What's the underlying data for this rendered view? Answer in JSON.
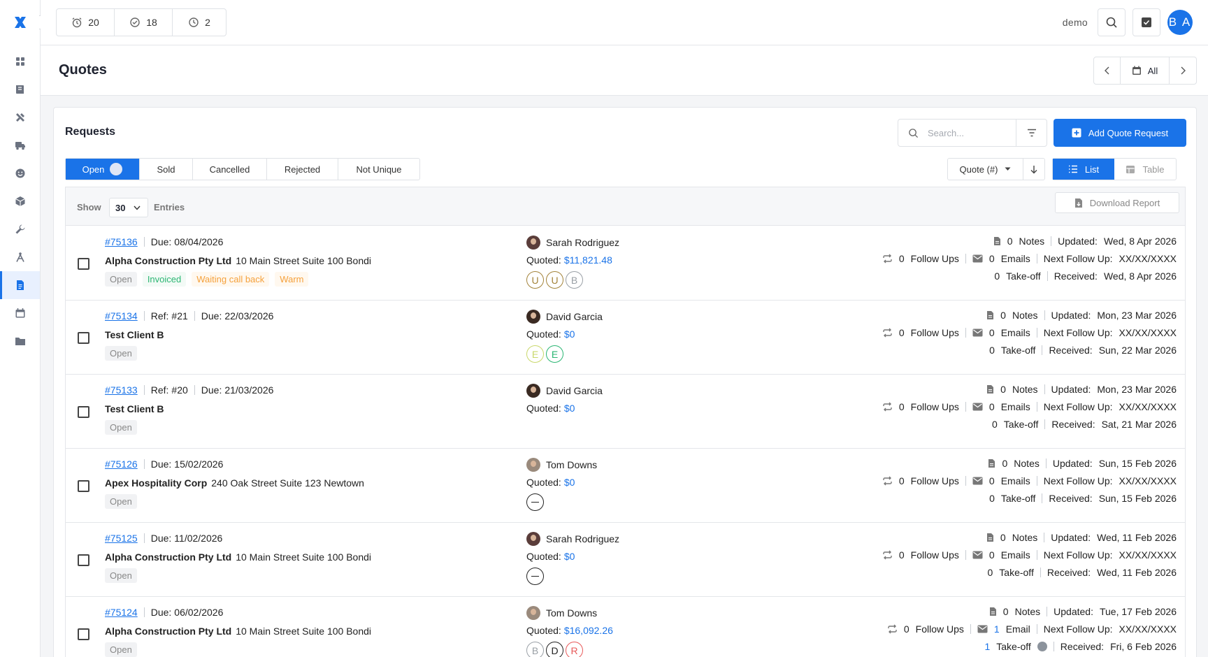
{
  "topbar": {
    "counters": [
      {
        "icon": "alarm-clock-icon",
        "value": "20"
      },
      {
        "icon": "check-circle-icon",
        "value": "18"
      },
      {
        "icon": "clock-progress-icon",
        "value": "2"
      }
    ],
    "user_name": "demo",
    "avatar_initials": "B A"
  },
  "sidebar": {
    "items": [
      {
        "name": "dashboard",
        "icon": "grid-icon"
      },
      {
        "name": "book",
        "icon": "book-icon"
      },
      {
        "name": "tools",
        "icon": "tools-icon"
      },
      {
        "name": "delivery",
        "icon": "truck-icon"
      },
      {
        "name": "customers",
        "icon": "smile-icon"
      },
      {
        "name": "products",
        "icon": "box-icon"
      },
      {
        "name": "service",
        "icon": "wrench-icon"
      },
      {
        "name": "drafting",
        "icon": "compass-icon"
      },
      {
        "name": "quotes",
        "icon": "document-icon",
        "active": true
      },
      {
        "name": "calendar",
        "icon": "calendar-icon"
      },
      {
        "name": "files",
        "icon": "folder-icon"
      }
    ]
  },
  "page": {
    "title": "Quotes",
    "period_label": "All"
  },
  "requests": {
    "title": "Requests",
    "search_placeholder": "Search...",
    "add_button": "Add Quote Request",
    "status_tabs": [
      "Open",
      "Sold",
      "Cancelled",
      "Rejected",
      "Not Unique"
    ],
    "active_tab": "Open",
    "sort_label": "Quote (#)",
    "views": [
      "List",
      "Table"
    ],
    "active_view": "List",
    "show_label": "Show",
    "entries_value": "30",
    "entries_label": "Entries",
    "download_label": "Download Report"
  },
  "labels": {
    "due": "Due:",
    "ref": "Ref:",
    "quoted": "Quoted:",
    "notes": "Notes",
    "updated": "Updated:",
    "follow_ups": "Follow Ups",
    "emails": "Emails",
    "email": "Email",
    "next_follow_up": "Next Follow Up:",
    "take_off": "Take-off",
    "received": "Received:"
  },
  "colors": {
    "accent": "#1a73e8",
    "tag_green": "#2bb673",
    "tag_orange": "#f5a13c"
  },
  "rows": [
    {
      "id": "#75136",
      "ref": "",
      "due": "08/04/2026",
      "client": "Alpha Construction Pty Ltd",
      "address": "10 Main Street Suite 100 Bondi",
      "tags": [
        {
          "text": "Open",
          "kind": "grey"
        },
        {
          "text": "Invoiced",
          "kind": "green"
        },
        {
          "text": "Waiting call back",
          "kind": "orange"
        },
        {
          "text": "Warm",
          "kind": "orange"
        }
      ],
      "assignee": "Sarah Rodriguez",
      "amount": "$11,821.48",
      "bubbles": [
        {
          "letter": "U",
          "color": "#a3833a"
        },
        {
          "letter": "U",
          "color": "#a3833a"
        },
        {
          "letter": "B",
          "color": "#9aa0a6"
        }
      ],
      "notes": "0",
      "updated": "Wed, 8 Apr 2026",
      "follow_ups": "0",
      "emails": "0",
      "email_label": "Emails",
      "next_follow_up": "XX/XX/XXXX",
      "take_off": "0",
      "received": "Wed, 8 Apr 2026",
      "highlight": false
    },
    {
      "id": "#75134",
      "ref": "#21",
      "due": "22/03/2026",
      "client": "Test Client B",
      "address": "",
      "tags": [
        {
          "text": "Open",
          "kind": "grey"
        }
      ],
      "assignee": "David Garcia",
      "amount": "$0",
      "bubbles": [
        {
          "letter": "E",
          "color": "#c9d86b"
        },
        {
          "letter": "E",
          "color": "#2bb673"
        }
      ],
      "notes": "0",
      "updated": "Mon, 23 Mar 2026",
      "follow_ups": "0",
      "emails": "0",
      "email_label": "Emails",
      "next_follow_up": "XX/XX/XXXX",
      "take_off": "0",
      "received": "Sun, 22 Mar 2026",
      "highlight": false
    },
    {
      "id": "#75133",
      "ref": "#20",
      "due": "21/03/2026",
      "client": "Test Client B",
      "address": "",
      "tags": [
        {
          "text": "Open",
          "kind": "grey"
        }
      ],
      "assignee": "David Garcia",
      "amount": "$0",
      "bubbles": [],
      "notes": "0",
      "updated": "Mon, 23 Mar 2026",
      "follow_ups": "0",
      "emails": "0",
      "email_label": "Emails",
      "next_follow_up": "XX/XX/XXXX",
      "take_off": "0",
      "received": "Sat, 21 Mar 2026",
      "highlight": false
    },
    {
      "id": "#75126",
      "ref": "",
      "due": "15/02/2026",
      "client": "Apex Hospitality Corp",
      "address": "240 Oak Street Suite 123 Newtown",
      "tags": [
        {
          "text": "Open",
          "kind": "grey"
        }
      ],
      "assignee": "Tom Downs",
      "amount": "$0",
      "bubbles": [
        {
          "letter": "",
          "color": "#222222",
          "none": true
        }
      ],
      "notes": "0",
      "updated": "Sun, 15 Feb 2026",
      "follow_ups": "0",
      "emails": "0",
      "email_label": "Emails",
      "next_follow_up": "XX/XX/XXXX",
      "take_off": "0",
      "received": "Sun, 15 Feb 2026",
      "highlight": false
    },
    {
      "id": "#75125",
      "ref": "",
      "due": "11/02/2026",
      "client": "Alpha Construction Pty Ltd",
      "address": "10 Main Street Suite 100 Bondi",
      "tags": [
        {
          "text": "Open",
          "kind": "grey"
        }
      ],
      "assignee": "Sarah Rodriguez",
      "amount": "$0",
      "bubbles": [
        {
          "letter": "",
          "color": "#222222",
          "none": true
        }
      ],
      "notes": "0",
      "updated": "Wed, 11 Feb 2026",
      "follow_ups": "0",
      "emails": "0",
      "email_label": "Emails",
      "next_follow_up": "XX/XX/XXXX",
      "take_off": "0",
      "received": "Wed, 11 Feb 2026",
      "highlight": false
    },
    {
      "id": "#75124",
      "ref": "",
      "due": "06/02/2026",
      "client": "Alpha Construction Pty Ltd",
      "address": "10 Main Street Suite 100 Bondi",
      "tags": [
        {
          "text": "Open",
          "kind": "grey"
        }
      ],
      "assignee": "Tom Downs",
      "amount": "$16,092.26",
      "bubbles": [
        {
          "letter": "B",
          "color": "#9aa0a6"
        },
        {
          "letter": "D",
          "color": "#222222"
        },
        {
          "letter": "R",
          "color": "#e85a5a"
        }
      ],
      "notes": "0",
      "updated": "Tue, 17 Feb 2026",
      "follow_ups": "0",
      "emails": "1",
      "email_label": "Email",
      "next_follow_up": "XX/XX/XXXX",
      "take_off": "1",
      "received": "Fri, 6 Feb 2026",
      "highlight": true
    }
  ]
}
